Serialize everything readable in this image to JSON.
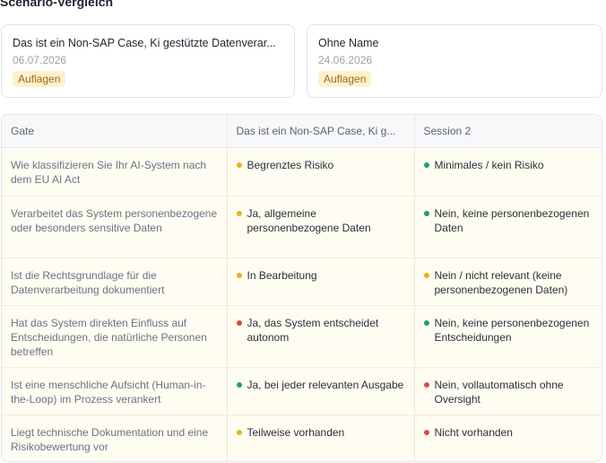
{
  "page": {
    "title": "Scenario-Vergleich"
  },
  "scenarios": [
    {
      "name": "Das ist ein Non-SAP Case, Ki gestützte Datenverar...",
      "date": "06.07.2026",
      "badge": "Auflagen"
    },
    {
      "name": "Ohne Name",
      "date": "24.06.2026",
      "badge": "Auflagen"
    }
  ],
  "table": {
    "headers": [
      "Gate",
      "Das ist ein Non-SAP Case, Ki g...",
      "Session 2"
    ],
    "rows": [
      {
        "gate": "Wie klassifizieren Sie Ihr AI-System nach dem EU AI Act",
        "a": {
          "text": "Begrenztes Risiko",
          "status": "yellow"
        },
        "b": {
          "text": "Minimales / kein Risiko",
          "status": "green"
        }
      },
      {
        "gate": "Verarbeitet das System personenbezogene oder besonders sensitive Daten",
        "a": {
          "text": "Ja, allgemeine personenbezogene Daten",
          "status": "yellow"
        },
        "b": {
          "text": "Nein, keine personenbezogenen Daten",
          "status": "green"
        }
      },
      {
        "gate": "Ist die Rechtsgrundlage für die Datenverarbeitung dokumentiert",
        "a": {
          "text": "In Bearbeitung",
          "status": "yellow"
        },
        "b": {
          "text": "Nein / nicht relevant (keine personenbezogenen Daten)",
          "status": "yellow"
        }
      },
      {
        "gate": "Hat das System direkten Einfluss auf Entscheidungen, die natürliche Personen betreffen",
        "a": {
          "text": "Ja, das System entscheidet autonom",
          "status": "red"
        },
        "b": {
          "text": "Nein, keine personenbezogenen Entscheidungen",
          "status": "green"
        }
      },
      {
        "gate": "Ist eine menschliche Aufsicht (Human-in-the-Loop) im Prozess verankert",
        "a": {
          "text": "Ja, bei jeder relevanten Ausgabe",
          "status": "green"
        },
        "b": {
          "text": "Nein, vollautomatisch ohne Oversight",
          "status": "red"
        }
      },
      {
        "gate": "Liegt technische Dokumentation und eine Risikobewertung vor",
        "a": {
          "text": "Teilweise vorhanden",
          "status": "yellow"
        },
        "b": {
          "text": "Nicht vorhanden",
          "status": "red"
        }
      }
    ]
  }
}
